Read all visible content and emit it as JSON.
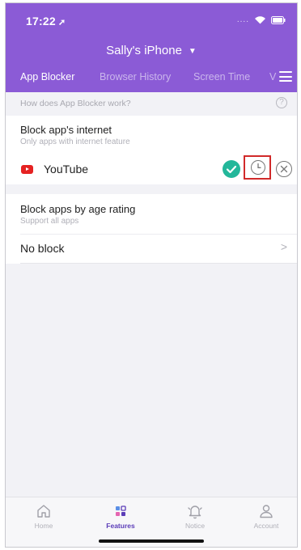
{
  "status_bar": {
    "time": "17:22"
  },
  "header": {
    "device_name": "Sally's iPhone",
    "tabs": [
      {
        "label": "App Blocker",
        "active": true
      },
      {
        "label": "Browser History",
        "active": false
      },
      {
        "label": "Screen Time",
        "active": false
      },
      {
        "label": "V",
        "active": false
      }
    ],
    "accent_color": "#8b5bd6"
  },
  "help": {
    "text": "How does App Blocker work?",
    "icon": "?"
  },
  "block_internet": {
    "title": "Block app's internet",
    "subtitle": "Only apps with internet feature",
    "apps": [
      {
        "name": "YouTube",
        "enabled": true
      }
    ]
  },
  "age_rating": {
    "title": "Block apps by age rating",
    "subtitle": "Support all apps",
    "value": "No block"
  },
  "tabbar": {
    "items": [
      {
        "label": "Home",
        "icon": "home-icon",
        "active": false
      },
      {
        "label": "Features",
        "icon": "features-icon",
        "active": true
      },
      {
        "label": "Notice",
        "icon": "bell-icon",
        "active": false
      },
      {
        "label": "Account",
        "icon": "person-icon",
        "active": false
      }
    ],
    "active_color": "#5b3db8"
  }
}
